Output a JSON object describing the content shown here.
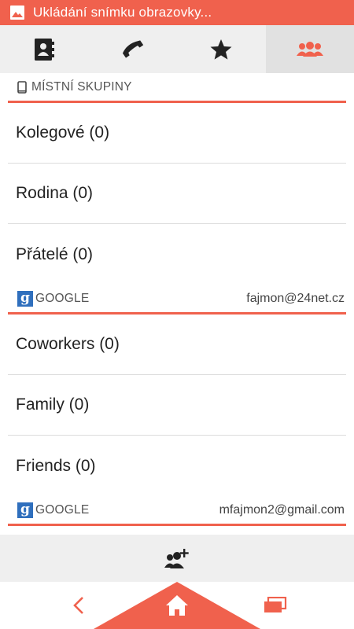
{
  "status_bar": {
    "notification_text": "Ukládání snímku obrazovky...",
    "icon": "image-icon",
    "color": "#f0614d"
  },
  "tabs": [
    {
      "name": "contacts",
      "icon": "contact-book-icon",
      "selected": false
    },
    {
      "name": "phone",
      "icon": "phone-icon",
      "selected": false
    },
    {
      "name": "favorites",
      "icon": "star-icon",
      "selected": false
    },
    {
      "name": "groups",
      "icon": "groups-icon",
      "selected": true
    }
  ],
  "local_section": {
    "title": "MÍSTNÍ SKUPINY",
    "icon": "phone-device-icon",
    "groups": [
      "Kolegové (0)",
      "Rodina (0)",
      "Přátelé (0)"
    ]
  },
  "google_section_1": {
    "title": "GOOGLE",
    "account": "fajmon@24net.cz",
    "icon": "google-icon",
    "groups": [
      "Coworkers (0)",
      "Family (0)",
      "Friends (0)"
    ]
  },
  "google_section_2": {
    "title": "GOOGLE",
    "account": "mfajmon2@gmail.com",
    "icon": "google-icon"
  },
  "bottom_bar": {
    "action_icon": "add-group-icon"
  },
  "nav_bar": {
    "buttons": [
      "back-icon",
      "home-icon",
      "recent-apps-icon"
    ],
    "accent": "#f0614d"
  },
  "colors": {
    "accent": "#f0614d",
    "tab_bg": "#efefef",
    "selected_tab_bg": "#e1e1e1",
    "divider": "#dcdcdc"
  }
}
